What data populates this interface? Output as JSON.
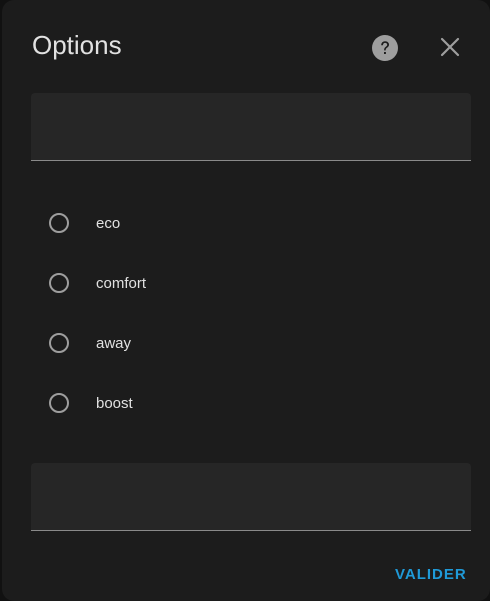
{
  "dialog": {
    "title": "Options",
    "help_icon": "help-circle-icon",
    "close_icon": "close-icon"
  },
  "fields": {
    "top": {
      "value": "",
      "placeholder": ""
    },
    "bottom": {
      "value": "",
      "placeholder": ""
    }
  },
  "options": {
    "items": [
      {
        "label": "eco",
        "selected": false
      },
      {
        "label": "comfort",
        "selected": false
      },
      {
        "label": "away",
        "selected": false
      },
      {
        "label": "boost",
        "selected": false
      }
    ]
  },
  "actions": {
    "submit_label": "VALIDER",
    "accent_color": "#1f9ad8"
  },
  "colors": {
    "dialog_bg": "#1c1c1c",
    "field_bg": "#262626",
    "text": "#e1e1e1",
    "icon": "#9e9e9e"
  }
}
